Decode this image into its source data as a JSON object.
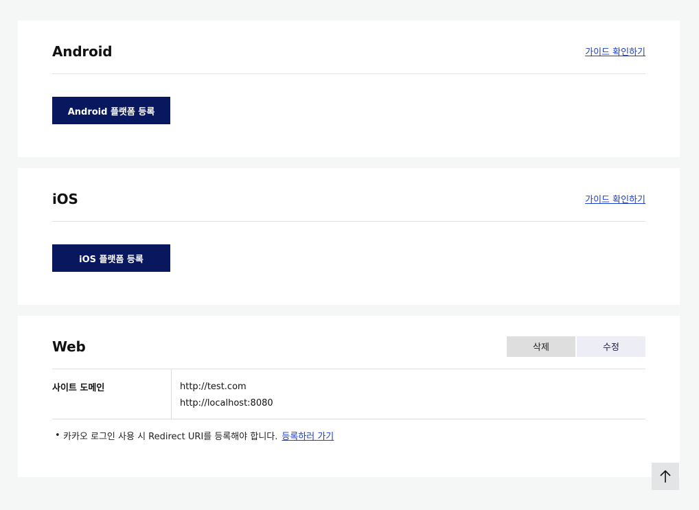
{
  "android": {
    "title": "Android",
    "guide_link": "가이드 확인하기",
    "register_button": "Android 플랫폼 등록"
  },
  "ios": {
    "title": "iOS",
    "guide_link": "가이드 확인하기",
    "register_button": "iOS 플랫폼 등록"
  },
  "web": {
    "title": "Web",
    "delete_button": "삭제",
    "edit_button": "수정",
    "domain_label": "사이트 도메인",
    "domains": [
      "http://test.com",
      "http://localhost:8080"
    ],
    "note_bullet": "•",
    "note_text": "카카오 로그인 사용 시 Redirect URI를 등록해야 합니다.",
    "note_link": "등록하러 가기"
  },
  "scroll_top": {
    "icon": "arrow-up-icon"
  },
  "colors": {
    "primary_button": "#08175e",
    "link": "#1a3bd1",
    "page_bg": "#f5f6f6"
  }
}
